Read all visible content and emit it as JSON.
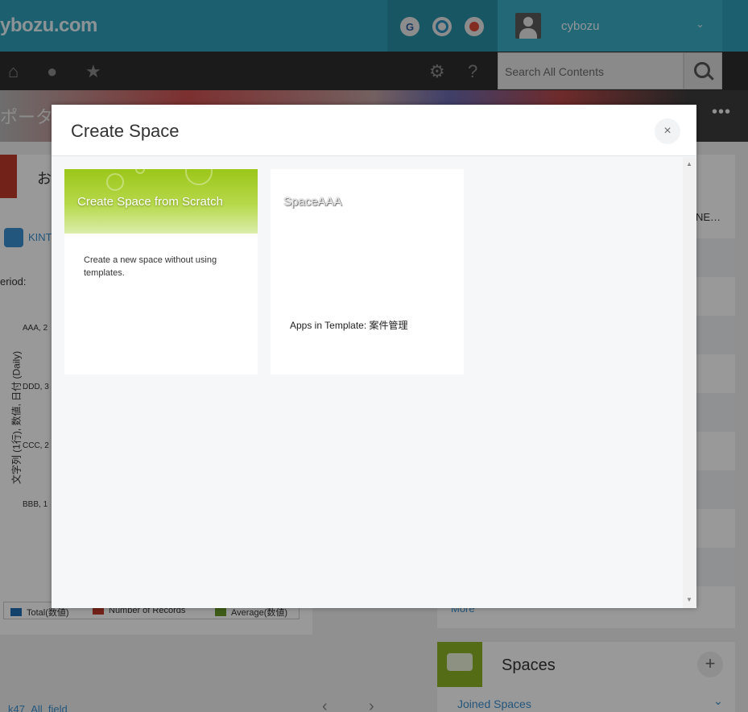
{
  "app": {
    "logo_text": "ybozu.com",
    "user_name": "cybozu",
    "services": [
      {
        "name": "G",
        "icon": "garoon-icon"
      },
      {
        "name": "O",
        "icon": "office-icon"
      },
      {
        "name": "M",
        "icon": "mailwise-icon"
      }
    ],
    "search": {
      "placeholder": "Search All Contents"
    },
    "portal_title": "ポータル",
    "notice_title": "お",
    "kintone_label": "KINT",
    "period_label": "eriod:",
    "chart": {
      "y_axis_label": "文字列 (1行), 数値, 日付 (Daily)",
      "categories": [
        "AAA, 2",
        "DDD, 3",
        "CCC, 2",
        "BBB, 1"
      ],
      "legend": [
        "Total(数値)",
        "Number of Records",
        "Average(数値)"
      ],
      "legend_colors": [
        "#1f6fb5",
        "#c0392b",
        "#6a9a2a"
      ]
    },
    "right_panel": {
      "truncated_text": "NE…",
      "more_link": "More"
    },
    "spaces": {
      "title": "Spaces",
      "add": "+",
      "joined": "Joined Spaces"
    },
    "bottom_link": "k47_All_field"
  },
  "dialog": {
    "title": "Create Space",
    "close": "×",
    "cards": [
      {
        "title": "Create Space from Scratch",
        "description": "Create a new space without using templates."
      },
      {
        "title": "SpaceAAA",
        "apps_label": "Apps in Template:",
        "apps_value": "案件管理"
      }
    ]
  }
}
